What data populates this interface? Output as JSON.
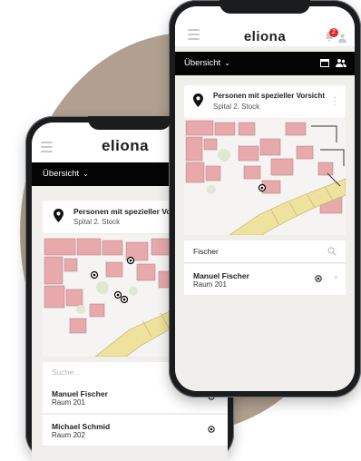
{
  "app": {
    "logo": "eliona",
    "notifications_count": "2"
  },
  "toolbar": {
    "title": "Übersicht",
    "chevron": "⌄"
  },
  "location": {
    "title": "Personen mit spezieller Vorsicht",
    "subtitle": "Spital 2. Stock"
  },
  "back_phone": {
    "search": {
      "placeholder": "Suche..."
    },
    "results": [
      {
        "name": "Manuel Fischer",
        "room": "Raum 201"
      },
      {
        "name": "Michael Schmid",
        "room": "Raum 202"
      }
    ]
  },
  "front_phone": {
    "search": {
      "value": "Fischer"
    },
    "results": [
      {
        "name": "Manuel Fischer",
        "room": "Raum 201"
      }
    ]
  },
  "colors": {
    "background_blob": "#b1a08f",
    "toolbar": "#050505",
    "room_red": "#e7a9ab",
    "room_yellow": "#efe29d",
    "badge": "#e3262b"
  }
}
